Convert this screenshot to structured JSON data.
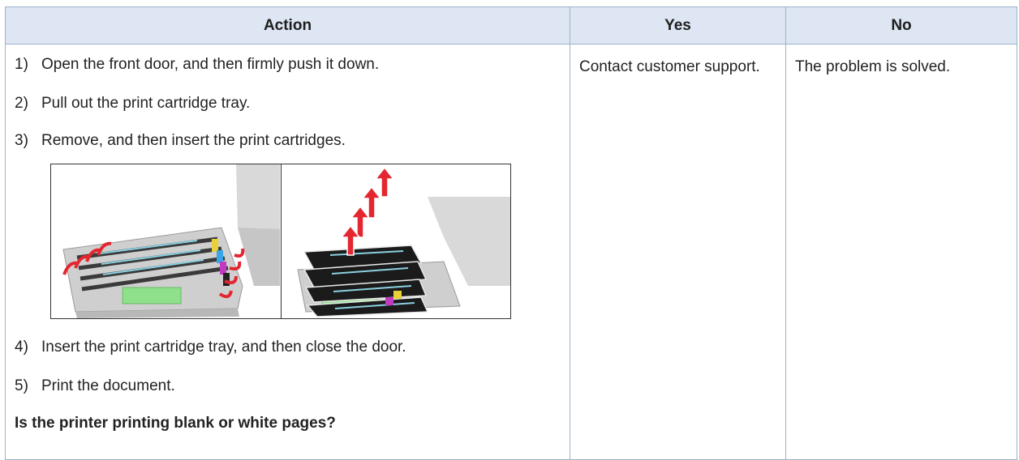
{
  "table": {
    "headers": {
      "action": "Action",
      "yes": "Yes",
      "no": "No"
    },
    "steps_before": [
      {
        "num": "1)",
        "text": "Open the front door, and then firmly push it down."
      },
      {
        "num": "2)",
        "text": "Pull out the print cartridge tray."
      },
      {
        "num": "3)",
        "text": "Remove, and then insert the print cartridges."
      }
    ],
    "steps_after": [
      {
        "num": "4)",
        "text": "Insert the print cartridge tray, and then close the door."
      },
      {
        "num": "5)",
        "text": "Print the document."
      }
    ],
    "question": "Is the printer printing blank or white pages?",
    "yes_text": "Contact customer support.",
    "no_text": "The problem is solved."
  },
  "colors": {
    "header_bg": "#dde6f2",
    "border": "#9cb2cc",
    "arrow": "#e3262f",
    "tray_green": "#8fe08a"
  }
}
